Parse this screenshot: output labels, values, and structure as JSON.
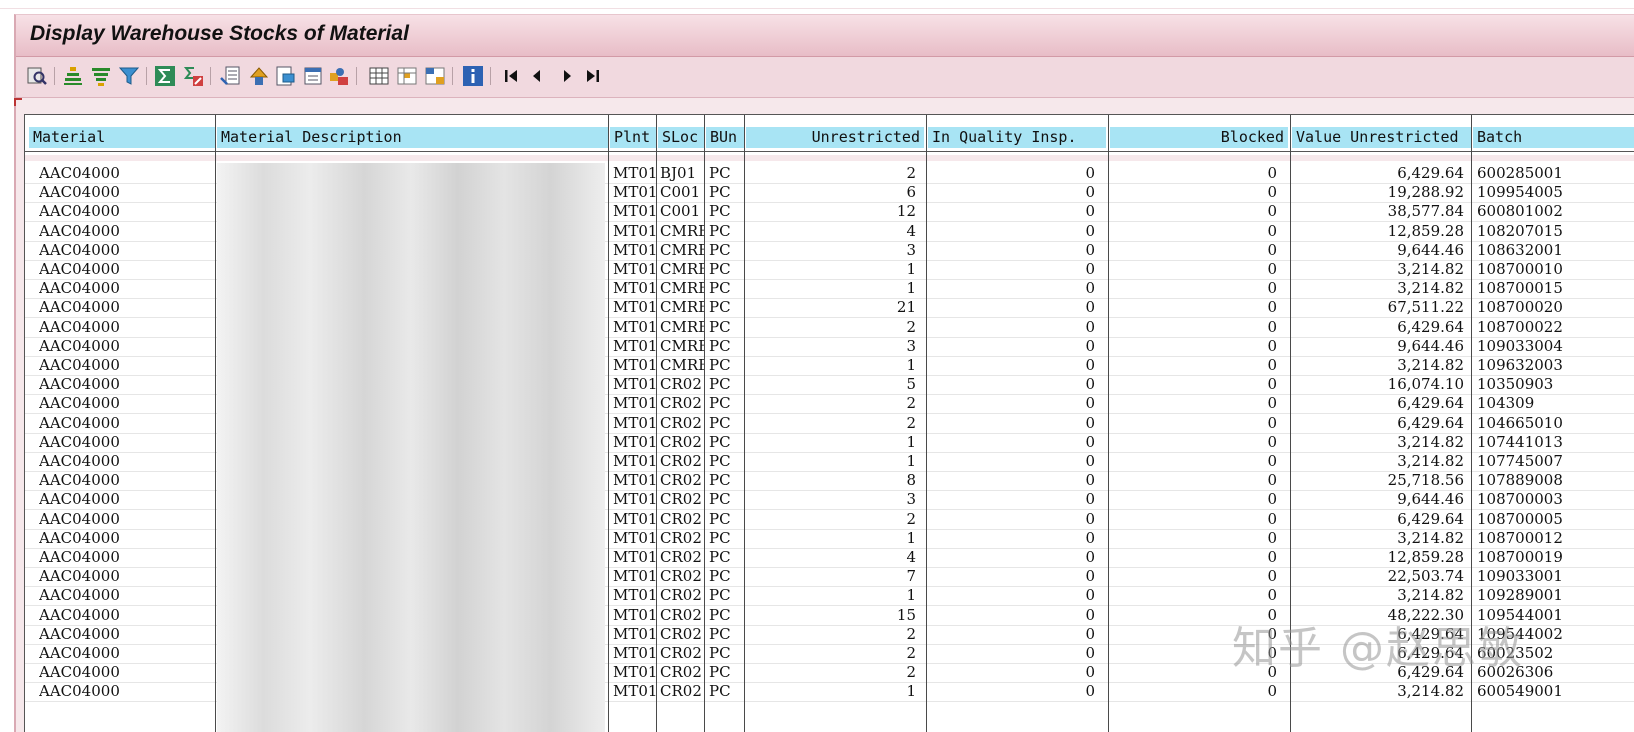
{
  "window": {
    "title": "Display Warehouse Stocks of Material"
  },
  "toolbar": {
    "icons": [
      "details-icon",
      "sort-ascending-icon",
      "sort-descending-icon",
      "filter-icon",
      "total-icon",
      "subtotal-icon",
      "export-icon",
      "local-file-icon",
      "print-preview-icon",
      "abc-analysis-icon",
      "graphic-icon",
      "change-layout-icon",
      "select-layout-icon",
      "save-layout-icon",
      "info-icon",
      "first-page-icon",
      "previous-page-icon",
      "next-page-icon",
      "last-page-icon"
    ]
  },
  "table": {
    "columns": [
      "Material",
      "Material Description",
      "Plnt",
      "SLoc",
      "BUn",
      "Unrestricted",
      "In Quality Insp.",
      "Blocked",
      "Value Unrestricted",
      "Batch"
    ],
    "rows": [
      [
        "AAC04000",
        "",
        "MT01",
        "BJ01",
        "PC",
        "2",
        "0",
        "0",
        "6,429.64",
        "600285001"
      ],
      [
        "AAC04000",
        "",
        "MT01",
        "C001",
        "PC",
        "6",
        "0",
        "0",
        "19,288.92",
        "109954005"
      ],
      [
        "AAC04000",
        "",
        "MT01",
        "C001",
        "PC",
        "12",
        "0",
        "0",
        "38,577.84",
        "600801002"
      ],
      [
        "AAC04000",
        "",
        "MT01",
        "CMRB",
        "PC",
        "4",
        "0",
        "0",
        "12,859.28",
        "108207015"
      ],
      [
        "AAC04000",
        "",
        "MT01",
        "CMRB",
        "PC",
        "3",
        "0",
        "0",
        "9,644.46",
        "108632001"
      ],
      [
        "AAC04000",
        "",
        "MT01",
        "CMRB",
        "PC",
        "1",
        "0",
        "0",
        "3,214.82",
        "108700010"
      ],
      [
        "AAC04000",
        "",
        "MT01",
        "CMRB",
        "PC",
        "1",
        "0",
        "0",
        "3,214.82",
        "108700015"
      ],
      [
        "AAC04000",
        "",
        "MT01",
        "CMRB",
        "PC",
        "21",
        "0",
        "0",
        "67,511.22",
        "108700020"
      ],
      [
        "AAC04000",
        "",
        "MT01",
        "CMRB",
        "PC",
        "2",
        "0",
        "0",
        "6,429.64",
        "108700022"
      ],
      [
        "AAC04000",
        "",
        "MT01",
        "CMRB",
        "PC",
        "3",
        "0",
        "0",
        "9,644.46",
        "109033004"
      ],
      [
        "AAC04000",
        "",
        "MT01",
        "CMRB",
        "PC",
        "1",
        "0",
        "0",
        "3,214.82",
        "109632003"
      ],
      [
        "AAC04000",
        "",
        "MT01",
        "CR02",
        "PC",
        "5",
        "0",
        "0",
        "16,074.10",
        "10350903"
      ],
      [
        "AAC04000",
        "",
        "MT01",
        "CR02",
        "PC",
        "2",
        "0",
        "0",
        "6,429.64",
        "104309"
      ],
      [
        "AAC04000",
        "",
        "MT01",
        "CR02",
        "PC",
        "2",
        "0",
        "0",
        "6,429.64",
        "104665010"
      ],
      [
        "AAC04000",
        "",
        "MT01",
        "CR02",
        "PC",
        "1",
        "0",
        "0",
        "3,214.82",
        "107441013"
      ],
      [
        "AAC04000",
        "",
        "MT01",
        "CR02",
        "PC",
        "1",
        "0",
        "0",
        "3,214.82",
        "107745007"
      ],
      [
        "AAC04000",
        "",
        "MT01",
        "CR02",
        "PC",
        "8",
        "0",
        "0",
        "25,718.56",
        "107889008"
      ],
      [
        "AAC04000",
        "",
        "MT01",
        "CR02",
        "PC",
        "3",
        "0",
        "0",
        "9,644.46",
        "108700003"
      ],
      [
        "AAC04000",
        "",
        "MT01",
        "CR02",
        "PC",
        "2",
        "0",
        "0",
        "6,429.64",
        "108700005"
      ],
      [
        "AAC04000",
        "",
        "MT01",
        "CR02",
        "PC",
        "1",
        "0",
        "0",
        "3,214.82",
        "108700012"
      ],
      [
        "AAC04000",
        "",
        "MT01",
        "CR02",
        "PC",
        "4",
        "0",
        "0",
        "12,859.28",
        "108700019"
      ],
      [
        "AAC04000",
        "",
        "MT01",
        "CR02",
        "PC",
        "7",
        "0",
        "0",
        "22,503.74",
        "109033001"
      ],
      [
        "AAC04000",
        "",
        "MT01",
        "CR02",
        "PC",
        "1",
        "0",
        "0",
        "3,214.82",
        "109289001"
      ],
      [
        "AAC04000",
        "",
        "MT01",
        "CR02",
        "PC",
        "15",
        "0",
        "0",
        "48,222.30",
        "109544001"
      ],
      [
        "AAC04000",
        "",
        "MT01",
        "CR02",
        "PC",
        "2",
        "0",
        "0",
        "6,429.64",
        "109544002"
      ],
      [
        "AAC04000",
        "",
        "MT01",
        "CR02",
        "PC",
        "2",
        "0",
        "0",
        "6,429.64",
        "60023502"
      ],
      [
        "AAC04000",
        "",
        "MT01",
        "CR02",
        "PC",
        "2",
        "0",
        "0",
        "6,429.64",
        "60026306"
      ],
      [
        "AAC04000",
        "",
        "MT01",
        "CR02",
        "PC",
        "1",
        "0",
        "0",
        "3,214.82",
        "600549001"
      ]
    ]
  },
  "watermark": {
    "text": "知乎 @赵思敏"
  },
  "colors": {
    "header_bg": "#a8e4f4",
    "frame_bg": "#f6e8eb",
    "title_bg": "#e8bdc7"
  }
}
